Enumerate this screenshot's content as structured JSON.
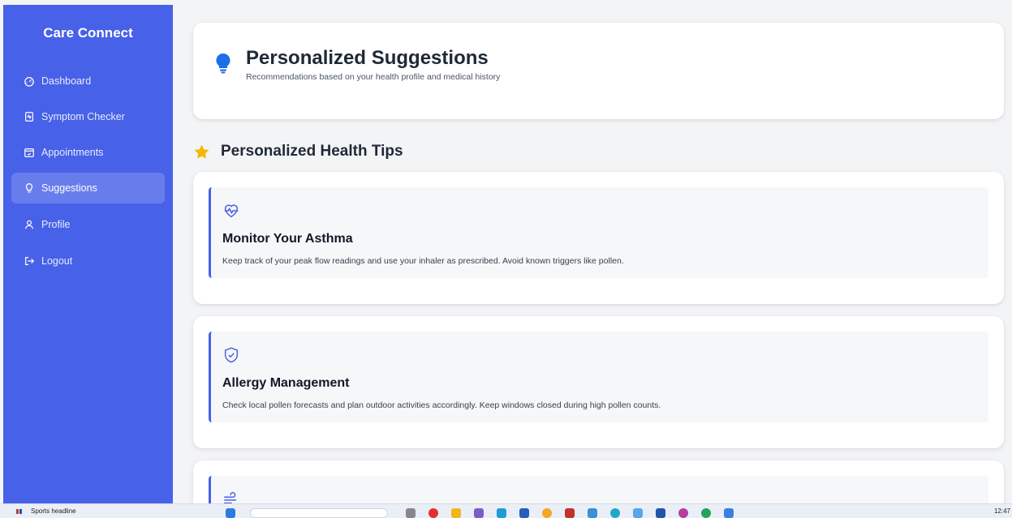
{
  "sidebar": {
    "brand": "Care Connect",
    "items": [
      {
        "label": "Dashboard",
        "icon": "dashboard-icon"
      },
      {
        "label": "Symptom Checker",
        "icon": "symptom-checker-icon"
      },
      {
        "label": "Appointments",
        "icon": "calendar-check-icon"
      },
      {
        "label": "Suggestions",
        "icon": "lightbulb-icon",
        "active": true
      },
      {
        "label": "Profile",
        "icon": "user-icon"
      },
      {
        "label": "Logout",
        "icon": "logout-icon"
      }
    ]
  },
  "header": {
    "title": "Personalized Suggestions",
    "subtitle": "Recommendations based on your health profile and medical history"
  },
  "section": {
    "title": "Personalized Health Tips"
  },
  "tips": [
    {
      "title": "Monitor Your Asthma",
      "text": "Keep track of your peak flow readings and use your inhaler as prescribed. Avoid known triggers like pollen.",
      "icon": "heart-pulse-icon"
    },
    {
      "title": "Allergy Management",
      "text": "Check local pollen forecasts and plan outdoor activities accordingly. Keep windows closed during high pollen counts.",
      "icon": "shield-check-icon"
    },
    {
      "title": "",
      "text": "",
      "icon": "wind-icon"
    }
  ],
  "taskbar": {
    "news": "Sports headline",
    "clock": "12:47"
  },
  "colors": {
    "sidebar": "#4761e8",
    "accent": "#4761e8",
    "bulb": "#1d6fe8",
    "star": "#f5b800"
  }
}
